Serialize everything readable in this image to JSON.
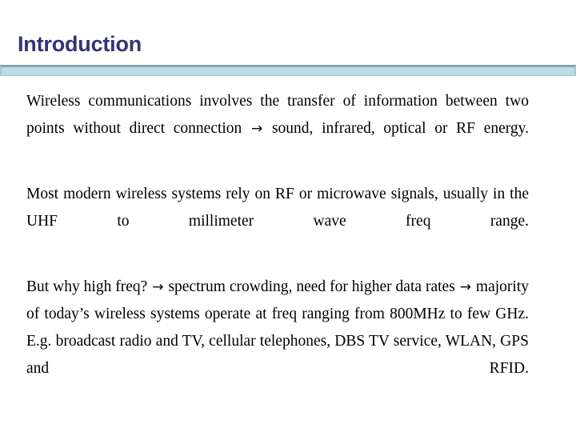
{
  "slide": {
    "title": "Introduction",
    "title_color": "#333377",
    "rule_fill_color": "#b9dde2",
    "rule_border_color": "#84a7ad",
    "background_color": "#ffffff",
    "body_text_color": "#000000",
    "arrow_glyph": "→",
    "paragraphs": [
      {
        "id": "paragraph-1",
        "segments": [
          "Wireless communications involves the transfer of information between two points without direct connection ",
          "ARROW",
          " sound, infrared, optical or RF energy."
        ],
        "plain_text": "Wireless communications involves the transfer of information between two points without direct connection → sound, infrared, optical or RF energy."
      },
      {
        "id": "paragraph-2",
        "segments": [
          "Most modern wireless systems rely on RF or microwave signals, usually in the UHF to millimeter wave freq range."
        ],
        "plain_text": "Most modern wireless systems rely on RF or microwave signals, usually in the UHF to millimeter wave freq range."
      },
      {
        "id": "paragraph-3",
        "segments": [
          "But why high freq? ",
          "ARROW",
          " spectrum crowding, need for higher data rates ",
          "ARROW",
          " majority of today’s wireless systems operate at freq ranging from 800MHz to few GHz. E.g. broadcast radio and TV, cellular telephones, DBS TV service, WLAN, GPS and RFID."
        ],
        "plain_text": "But why high freq? → spectrum crowding, need for higher data rates → majority of today’s wireless systems operate at freq ranging from 800MHz to few GHz. E.g. broadcast radio and TV, cellular telephones, DBS TV service, WLAN, GPS and RFID."
      }
    ]
  }
}
